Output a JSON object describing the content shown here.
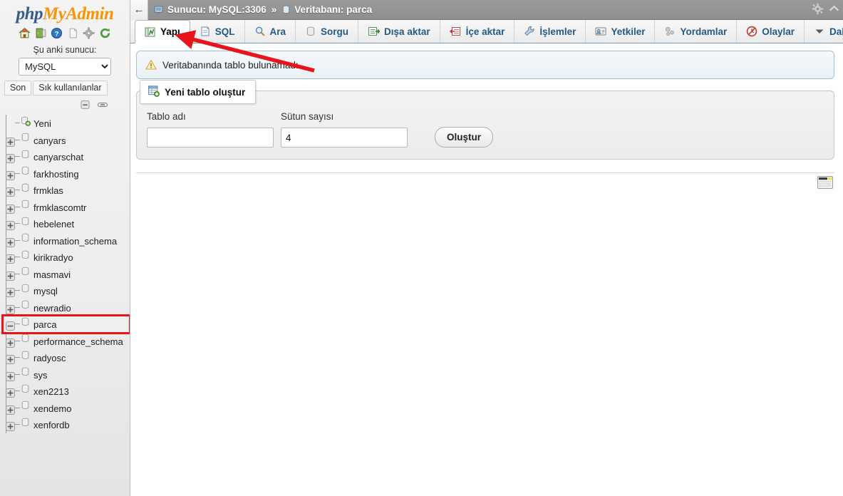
{
  "sidebar": {
    "logo": {
      "part1": "php",
      "part2": "My",
      "part3": "Admin"
    },
    "icons": [
      {
        "name": "home-icon",
        "label": "Ana sayfa"
      },
      {
        "name": "logout-icon",
        "label": "Oturumu kapat"
      },
      {
        "name": "help-icon",
        "label": "Yardım"
      },
      {
        "name": "docs-icon",
        "label": "Belgeler"
      },
      {
        "name": "settings-icon",
        "label": "Ayarlar"
      },
      {
        "name": "refresh-icon",
        "label": "Yenile"
      }
    ],
    "current_server_label": "Şu anki sunucu:",
    "server_options": [
      "MySQL"
    ],
    "server_selected": "MySQL",
    "quick_tabs": [
      {
        "label": "Son",
        "active": false
      },
      {
        "label": "Sık kullanılanlar",
        "active": false
      }
    ],
    "tree_tools": [
      {
        "name": "collapse-all-icon",
        "label": "Hepsini daralt"
      },
      {
        "name": "toggle-link-icon",
        "label": "Bağlantıyı aç/kapat"
      }
    ],
    "databases": [
      {
        "label": "Yeni",
        "type": "new",
        "expandable": false,
        "highlighted": false
      },
      {
        "label": "canyars",
        "type": "db",
        "expandable": true,
        "highlighted": false
      },
      {
        "label": "canyarschat",
        "type": "db",
        "expandable": true,
        "highlighted": false
      },
      {
        "label": "farkhosting",
        "type": "db",
        "expandable": true,
        "highlighted": false
      },
      {
        "label": "frmklas",
        "type": "db",
        "expandable": true,
        "highlighted": false
      },
      {
        "label": "frmklascomtr",
        "type": "db",
        "expandable": true,
        "highlighted": false
      },
      {
        "label": "hebelenet",
        "type": "db",
        "expandable": true,
        "highlighted": false
      },
      {
        "label": "information_schema",
        "type": "db",
        "expandable": true,
        "highlighted": false
      },
      {
        "label": "kirikradyo",
        "type": "db",
        "expandable": true,
        "highlighted": false
      },
      {
        "label": "masmavi",
        "type": "db",
        "expandable": true,
        "highlighted": false
      },
      {
        "label": "mysql",
        "type": "db",
        "expandable": true,
        "highlighted": false
      },
      {
        "label": "newradio",
        "type": "db",
        "expandable": true,
        "highlighted": false
      },
      {
        "label": "parca",
        "type": "db",
        "expandable": true,
        "highlighted": true
      },
      {
        "label": "performance_schema",
        "type": "db",
        "expandable": true,
        "highlighted": false
      },
      {
        "label": "radyosc",
        "type": "db",
        "expandable": true,
        "highlighted": false
      },
      {
        "label": "sys",
        "type": "db",
        "expandable": true,
        "highlighted": false
      },
      {
        "label": "xen2213",
        "type": "db",
        "expandable": true,
        "highlighted": false
      },
      {
        "label": "xendemo",
        "type": "db",
        "expandable": true,
        "highlighted": false
      },
      {
        "label": "xenfordb",
        "type": "db",
        "expandable": true,
        "highlighted": false
      }
    ]
  },
  "topbar": {
    "back_label": "←",
    "server_crumb": "Sunucu: MySQL:3306",
    "separator": "»",
    "database_crumb": "Veritabanı: parca",
    "right_icons": [
      {
        "name": "settings-gear-icon"
      },
      {
        "name": "collapse-chevron-icon"
      }
    ]
  },
  "tabs": [
    {
      "label": "Yapı",
      "icon": "structure-icon",
      "active": true
    },
    {
      "label": "SQL",
      "icon": "sql-icon",
      "active": false
    },
    {
      "label": "Ara",
      "icon": "search-icon",
      "active": false
    },
    {
      "label": "Sorgu",
      "icon": "query-icon",
      "active": false
    },
    {
      "label": "Dışa aktar",
      "icon": "export-icon",
      "active": false
    },
    {
      "label": "İçe aktar",
      "icon": "import-icon",
      "active": false
    },
    {
      "label": "İşlemler",
      "icon": "operations-icon",
      "active": false
    },
    {
      "label": "Yetkiler",
      "icon": "privileges-icon",
      "active": false
    },
    {
      "label": "Yordamlar",
      "icon": "routines-icon",
      "active": false
    },
    {
      "label": "Olaylar",
      "icon": "events-icon",
      "active": false
    },
    {
      "label": "Daha fazla",
      "icon": "chevron-down-icon",
      "active": false
    }
  ],
  "notice": {
    "icon": "warning-icon",
    "text": "Veritabanında tablo bulunamadı"
  },
  "create_table_panel": {
    "legend": "Yeni tablo oluştur",
    "legend_icon": "new-table-icon",
    "table_name_label": "Tablo adı",
    "table_name_value": "",
    "table_name_placeholder": "",
    "num_columns_label": "Sütun sayısı",
    "num_columns_value": "4",
    "create_button": "Oluştur"
  },
  "console": {
    "icon": "console-icon"
  },
  "colors": {
    "brand_blue": "#3a5a8c",
    "brand_orange": "#f89406",
    "topbar_gray": "#909090",
    "tab_link": "#235a86",
    "annotation_red": "#e8141a",
    "notice_border": "#a5bfd2"
  }
}
